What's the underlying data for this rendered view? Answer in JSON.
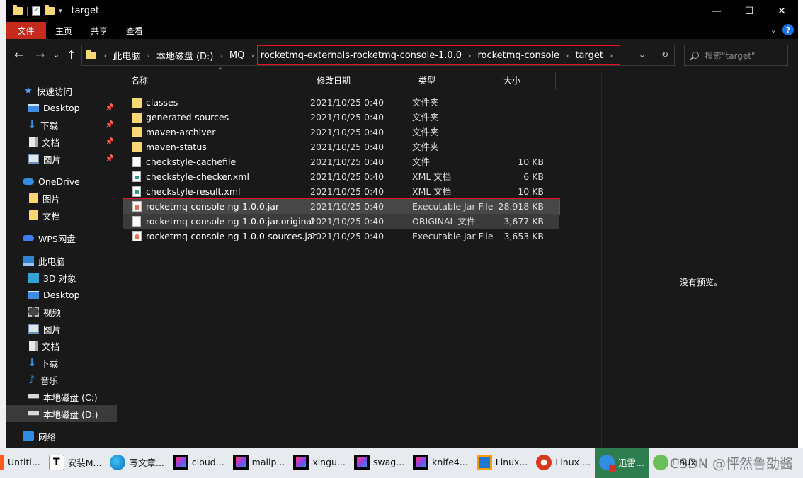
{
  "window": {
    "title": "target",
    "min_glyph": "—",
    "max_glyph": "☐",
    "close_glyph": "✕"
  },
  "ribbon": {
    "tabs": [
      "文件",
      "主页",
      "共享",
      "查看"
    ],
    "chevron": "⌄",
    "help": "?"
  },
  "nav": {
    "back": "←",
    "forward": "→",
    "recent": "⌄",
    "up": "↑",
    "breadcrumb": [
      "此电脑",
      "本地磁盘 (D:)",
      "MQ"
    ],
    "breadcrumb_highlighted": [
      "rocketmq-externals-rocketmq-console-1.0.0",
      "rocketmq-console",
      "target"
    ],
    "separator": "›",
    "history_dropdown": "⌄",
    "refresh": "↻",
    "search_placeholder": "搜索\"target\""
  },
  "sidebar": {
    "items": [
      {
        "label": "快速访问",
        "icon": "star-icon",
        "pinned": false
      },
      {
        "label": "Desktop",
        "icon": "desktop-icon",
        "pinned": true
      },
      {
        "label": "下载",
        "icon": "download-icon",
        "pinned": true
      },
      {
        "label": "文档",
        "icon": "document-icon",
        "pinned": true
      },
      {
        "label": "图片",
        "icon": "pictures-icon",
        "pinned": true
      },
      {
        "label": "OneDrive",
        "icon": "onedrive-icon",
        "pinned": false
      },
      {
        "label": "图片",
        "icon": "folder-icon",
        "pinned": false
      },
      {
        "label": "文档",
        "icon": "folder-icon",
        "pinned": false
      },
      {
        "label": "WPS网盘",
        "icon": "wps-cloud-icon",
        "pinned": false
      },
      {
        "label": "此电脑",
        "icon": "this-pc-icon",
        "pinned": false
      },
      {
        "label": "3D 对象",
        "icon": "3d-objects-icon",
        "pinned": false
      },
      {
        "label": "Desktop",
        "icon": "desktop-icon",
        "pinned": false
      },
      {
        "label": "视频",
        "icon": "video-icon",
        "pinned": false
      },
      {
        "label": "图片",
        "icon": "pictures-icon",
        "pinned": false
      },
      {
        "label": "文档",
        "icon": "document-icon",
        "pinned": false
      },
      {
        "label": "下载",
        "icon": "download-icon",
        "pinned": false
      },
      {
        "label": "音乐",
        "icon": "music-icon",
        "pinned": false
      },
      {
        "label": "本地磁盘 (C:)",
        "icon": "drive-icon",
        "pinned": false
      },
      {
        "label": "本地磁盘 (D:)",
        "icon": "drive-icon",
        "pinned": false
      },
      {
        "label": "网络",
        "icon": "network-icon",
        "pinned": false
      }
    ],
    "selected_label": "本地磁盘 (D:)"
  },
  "columns": {
    "name": "名称",
    "date": "修改日期",
    "type": "类型",
    "size": "大小"
  },
  "files": [
    {
      "name": "classes",
      "date": "2021/10/25 0:40",
      "type": "文件夹",
      "size": "",
      "icon": "folder-icon"
    },
    {
      "name": "generated-sources",
      "date": "2021/10/25 0:40",
      "type": "文件夹",
      "size": "",
      "icon": "folder-icon"
    },
    {
      "name": "maven-archiver",
      "date": "2021/10/25 0:40",
      "type": "文件夹",
      "size": "",
      "icon": "folder-icon"
    },
    {
      "name": "maven-status",
      "date": "2021/10/25 0:40",
      "type": "文件夹",
      "size": "",
      "icon": "folder-icon"
    },
    {
      "name": "checkstyle-cachefile",
      "date": "2021/10/25 0:40",
      "type": "文件",
      "size": "10 KB",
      "icon": "file-icon"
    },
    {
      "name": "checkstyle-checker.xml",
      "date": "2021/10/25 0:40",
      "type": "XML 文档",
      "size": "6 KB",
      "icon": "xml-file-icon"
    },
    {
      "name": "checkstyle-result.xml",
      "date": "2021/10/25 0:40",
      "type": "XML 文档",
      "size": "10 KB",
      "icon": "xml-file-icon"
    },
    {
      "name": "rocketmq-console-ng-1.0.0.jar",
      "date": "2021/10/25 0:40",
      "type": "Executable Jar File",
      "size": "28,918 KB",
      "icon": "jar-file-icon"
    },
    {
      "name": "rocketmq-console-ng-1.0.0.jar.original",
      "date": "2021/10/25 0:40",
      "type": "ORIGINAL 文件",
      "size": "3,677 KB",
      "icon": "file-icon"
    },
    {
      "name": "rocketmq-console-ng-1.0.0-sources.jar",
      "date": "2021/10/25 0:40",
      "type": "Executable Jar File",
      "size": "3,653 KB",
      "icon": "jar-file-icon"
    }
  ],
  "preview": {
    "text": "没有预览。"
  },
  "taskbar": {
    "items": [
      {
        "label": "Untitl...",
        "icon": "app-icon"
      },
      {
        "label": "安装M...",
        "icon": "typora-icon"
      },
      {
        "label": "写文章...",
        "icon": "edge-icon"
      },
      {
        "label": "cloud...",
        "icon": "intellij-icon"
      },
      {
        "label": "mallp...",
        "icon": "intellij-icon"
      },
      {
        "label": "xingu...",
        "icon": "intellij-icon"
      },
      {
        "label": "swag...",
        "icon": "intellij-icon"
      },
      {
        "label": "knife4...",
        "icon": "intellij-icon"
      },
      {
        "label": "Linux...",
        "icon": "vm-icon"
      },
      {
        "label": "Linux ...",
        "icon": "debian-icon"
      },
      {
        "label": "迅雷...",
        "icon": "thunder-icon"
      },
      {
        "label": "Linux...",
        "icon": "app-icon"
      }
    ],
    "watermark": "CSDN @怦然鲁劭酱",
    "active_index": 10
  },
  "colors": {
    "accent_red": "#e81123",
    "file_tab": "#c42b1c",
    "background": "#191919",
    "folder": "#f8d775"
  }
}
